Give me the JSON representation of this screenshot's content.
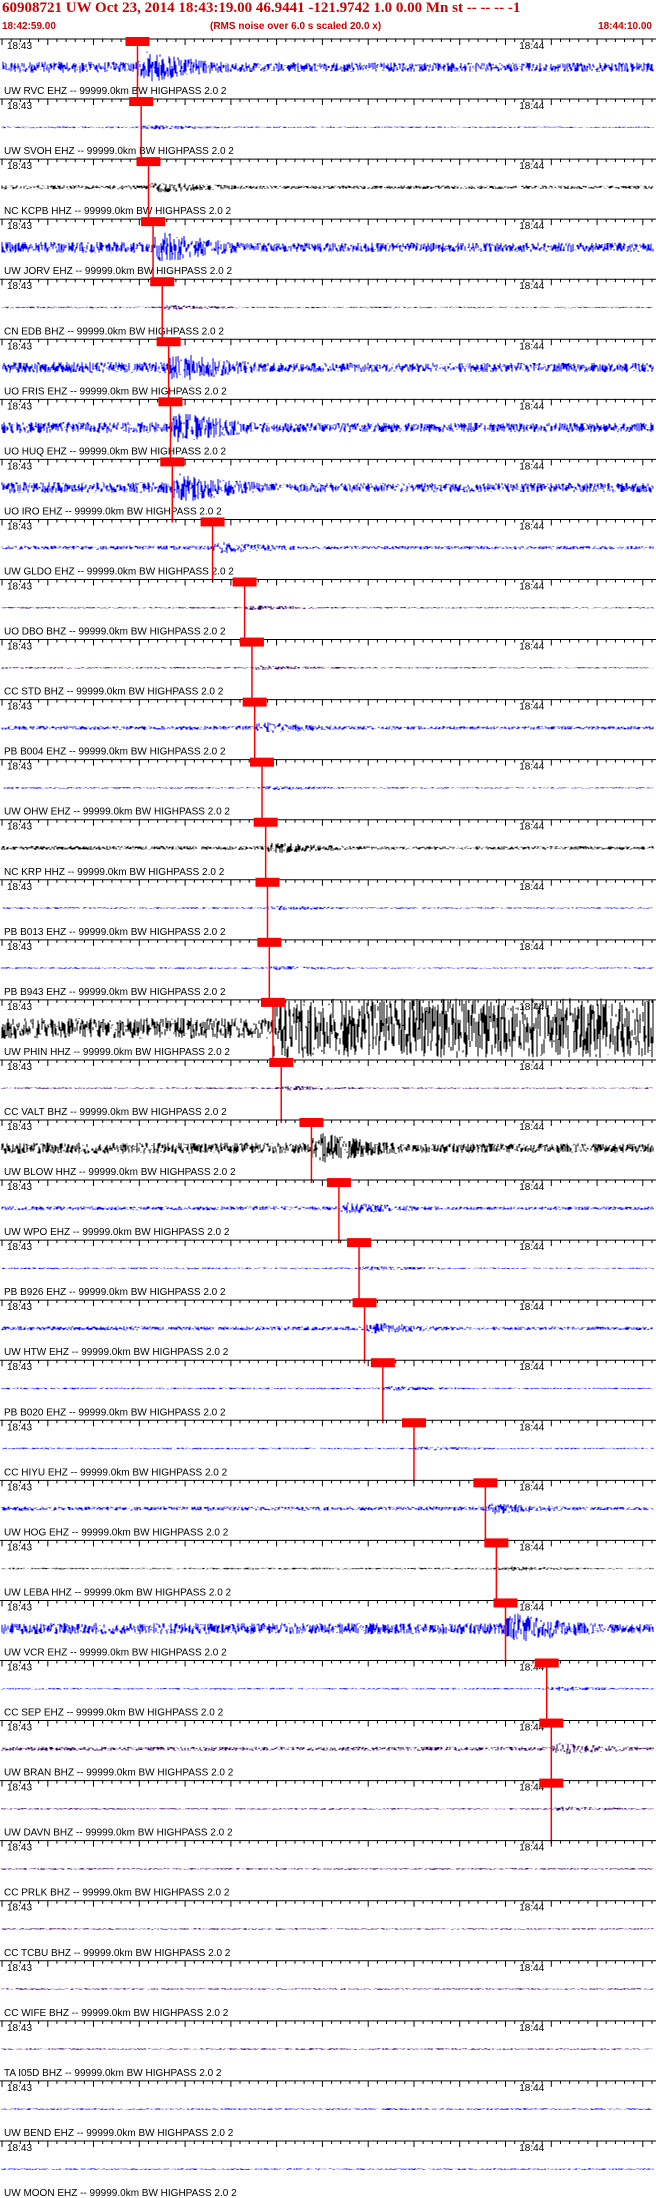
{
  "header": {
    "title": "60908721 UW Oct 23, 2014 18:43:19.00   46.9441 -121.9742  1.0 0.00 Mn st -- -- -- -1",
    "start_time": "18:42:59.00",
    "noise_note": "(RMS noise over 6.0 s scaled 20.0 x)",
    "end_time": "18:44:10.00"
  },
  "colors": {
    "title": "#cc0000",
    "pick_box": "#ff0000",
    "pick_line": "#ff0000",
    "trace_blue": "#0000ff",
    "trace_black": "#000000",
    "trace_purple": "#330066"
  },
  "chart_data": {
    "type": "seismogram",
    "x_unit": "seconds",
    "x_range": [
      0,
      71
    ],
    "marker_time_label": "18:43",
    "marker_time_label_right": "18:44",
    "traces": [
      {
        "top_label": "18:43",
        "station": "UW RVC EHZ -- 99999.0km BW  HIGHPASS  2.0  2",
        "pick": 14.8,
        "amplitude": "large",
        "color": "blue"
      },
      {
        "top_label": "18:43",
        "station": "UW SVOH EHZ -- 99999.0km BW  HIGHPASS  2.0  2",
        "pick": 15.2,
        "amplitude": "small",
        "color": "blue"
      },
      {
        "top_label": "18:43",
        "station": "NC KCPB HHZ -- 99999.0km BW  HIGHPASS  2.0  2",
        "pick": 16.0,
        "amplitude": "medium",
        "color": "black"
      },
      {
        "top_label": "18:43",
        "station": "UW JORV EHZ -- 99999.0km BW  HIGHPASS  2.0  2",
        "pick": 16.5,
        "amplitude": "large",
        "color": "blue"
      },
      {
        "top_label": "18:43",
        "station": "CN EDB BHZ -- 99999.0km BW  HIGHPASS  2.0  2",
        "pick": 17.5,
        "amplitude": "small",
        "color": "purple"
      },
      {
        "top_label": "18:43",
        "station": "UO FRIS EHZ -- 99999.0km BW  HIGHPASS  2.0  2",
        "pick": 18.2,
        "amplitude": "large",
        "color": "blue"
      },
      {
        "top_label": "18:43",
        "station": "UO HUQ EHZ -- 99999.0km BW  HIGHPASS  2.0  2",
        "pick": 18.4,
        "amplitude": "large",
        "color": "blue"
      },
      {
        "top_label": "18:43",
        "station": "UO IRO EHZ -- 99999.0km BW  HIGHPASS  2.0  2",
        "pick": 18.6,
        "amplitude": "large",
        "color": "blue"
      },
      {
        "top_label": "18:43",
        "station": "UW GLDO EHZ -- 99999.0km BW  HIGHPASS  2.0  2",
        "pick": 23.0,
        "amplitude": "medium",
        "color": "blue"
      },
      {
        "top_label": "18:43",
        "station": "UO DBO BHZ -- 99999.0km BW  HIGHPASS  2.0  2",
        "pick": 26.5,
        "amplitude": "small",
        "color": "purple"
      },
      {
        "top_label": "18:43",
        "station": "CC STD BHZ -- 99999.0km BW  HIGHPASS  2.0  2",
        "pick": 27.3,
        "amplitude": "small",
        "color": "purple"
      },
      {
        "top_label": "18:43",
        "station": "PB B004 EHZ -- 99999.0km BW  HIGHPASS  2.0  2",
        "pick": 27.6,
        "amplitude": "medium",
        "color": "blue"
      },
      {
        "top_label": "18:43",
        "station": "UW OHW EHZ -- 99999.0km BW  HIGHPASS  2.0  2",
        "pick": 28.4,
        "amplitude": "small",
        "color": "blue"
      },
      {
        "top_label": "18:43",
        "station": "NC KRP HHZ -- 99999.0km BW  HIGHPASS  2.0  2",
        "pick": 28.8,
        "amplitude": "medium",
        "color": "black"
      },
      {
        "top_label": "18:43",
        "station": "PB B013 EHZ -- 99999.0km BW  HIGHPASS  2.0  2",
        "pick": 29.0,
        "amplitude": "small",
        "color": "blue"
      },
      {
        "top_label": "18:43",
        "station": "PB B943 EHZ -- 99999.0km BW  HIGHPASS  2.0  2",
        "pick": 29.2,
        "amplitude": "small",
        "color": "blue"
      },
      {
        "top_label": "18:43",
        "top_label_right": "18:44",
        "station": "UW PHIN HHZ -- 99999.0km BW  HIGHPASS  2.0  2",
        "pick": 29.6,
        "amplitude": "saturated",
        "color": "black"
      },
      {
        "top_label": "18:43",
        "station": "CC VALT BHZ -- 99999.0km BW  HIGHPASS  2.0  2",
        "pick": 30.5,
        "amplitude": "small",
        "color": "purple"
      },
      {
        "top_label": "18:43",
        "station": "UW BLOW HHZ -- 99999.0km BW  HIGHPASS  2.0  2",
        "pick": 33.8,
        "amplitude": "large",
        "color": "black"
      },
      {
        "top_label": "18:43",
        "station": "UW WPO EHZ -- 99999.0km BW  HIGHPASS  2.0  2",
        "pick": 36.8,
        "amplitude": "medium",
        "color": "blue"
      },
      {
        "top_label": "18:43",
        "station": "PB B926 EHZ -- 99999.0km BW  HIGHPASS  2.0  2",
        "pick": 39.0,
        "amplitude": "small",
        "color": "blue"
      },
      {
        "top_label": "18:43",
        "station": "UW HTW EHZ -- 99999.0km BW  HIGHPASS  2.0  2",
        "pick": 39.6,
        "amplitude": "medium",
        "color": "blue"
      },
      {
        "top_label": "18:43",
        "station": "PB B020 EHZ -- 99999.0km BW  HIGHPASS  2.0  2",
        "pick": 41.6,
        "amplitude": "small",
        "color": "blue"
      },
      {
        "top_label": "18:43",
        "station": "CC HIYU EHZ -- 99999.0km BW  HIGHPASS  2.0  2",
        "pick": 45.0,
        "amplitude": "small",
        "color": "blue"
      },
      {
        "top_label": "18:43",
        "station": "UW HOG EHZ -- 99999.0km BW  HIGHPASS  2.0  2",
        "pick": 52.8,
        "amplitude": "medium",
        "color": "blue"
      },
      {
        "top_label": "18:43",
        "station": "UW LEBA HHZ -- 99999.0km BW  HIGHPASS  2.0  2",
        "pick": 54.0,
        "amplitude": "small",
        "color": "black"
      },
      {
        "top_label": "18:43",
        "station": "UW VCR EHZ -- 99999.0km BW  HIGHPASS  2.0  2",
        "pick": 55.0,
        "amplitude": "large",
        "color": "blue"
      },
      {
        "top_label": "18:43",
        "station": "CC SEP EHZ -- 99999.0km BW  HIGHPASS  2.0  2",
        "pick": 59.5,
        "amplitude": "small",
        "color": "blue"
      },
      {
        "top_label": "18:43",
        "station": "UW BRAN BHZ -- 99999.0km BW  HIGHPASS  2.0  2",
        "pick": 60.0,
        "amplitude": "medium",
        "color": "purple"
      },
      {
        "top_label": "18:43",
        "station": "UW DAVN BHZ -- 99999.0km BW  HIGHPASS  2.0  2",
        "pick": 60.0,
        "amplitude": "small",
        "color": "purple"
      },
      {
        "top_label": "18:43",
        "station": "CC PRLK BHZ -- 99999.0km BW  HIGHPASS  2.0  2",
        "pick": null,
        "amplitude": "small",
        "color": "purple"
      },
      {
        "top_label": "18:43",
        "station": "CC TCBU BHZ -- 99999.0km BW  HIGHPASS  2.0  2",
        "pick": null,
        "amplitude": "small",
        "color": "purple"
      },
      {
        "top_label": "18:43",
        "station": "CC WIFE BHZ -- 99999.0km BW  HIGHPASS  2.0  2",
        "pick": null,
        "amplitude": "small",
        "color": "purple"
      },
      {
        "top_label": "18:43",
        "station": "TA I05D BHZ -- 99999.0km BW  HIGHPASS  2.0  2",
        "pick": null,
        "amplitude": "small",
        "color": "purple"
      },
      {
        "top_label": "18:43",
        "station": "UW BEND EHZ -- 99999.0km BW  HIGHPASS  2.0  2",
        "pick": null,
        "amplitude": "small",
        "color": "blue"
      },
      {
        "top_label": "18:43",
        "station": "UW MOON EHZ -- 99999.0km BW  HIGHPASS  2.0  2",
        "pick": null,
        "amplitude": "small",
        "color": "blue"
      }
    ]
  }
}
